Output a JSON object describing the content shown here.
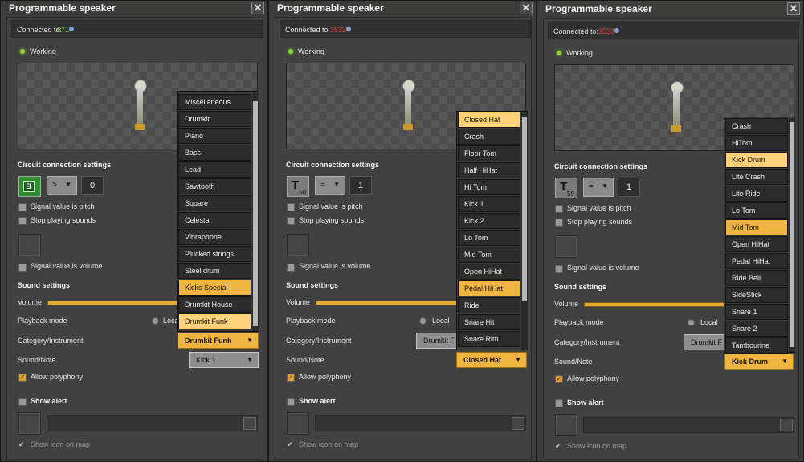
{
  "windows": [
    {
      "title": "Programmable speaker",
      "connected_label": "Connected to:",
      "connected_value": "671",
      "connected_color": "#7fcf4a",
      "status": "Working",
      "circuit_heading": "Circuit connection settings",
      "signal_icon": "green-chip-icon",
      "signal_sub": "",
      "comparator": ">",
      "constant": "0",
      "pitch_label": "Signal value is pitch",
      "stop_label": "Stop playing sounds",
      "volume_signal_label": "Signal value is volume",
      "sound_heading": "Sound settings",
      "volume_label": "Volume",
      "volume_fraction": 1.0,
      "playback_label": "Playback mode",
      "playback_option": "Local",
      "category_label": "Category/Instrument",
      "category_value": "Drumkit Funk",
      "note_label": "Sound/Note",
      "note_value": "Kick 1",
      "polyphony_label": "Allow polyphony",
      "alert_label": "Show alert",
      "show_icon_label": "Show icon on map",
      "dropdown_items": [
        "Miscellaneous",
        "Drumkit",
        "Piano",
        "Bass",
        "Lead",
        "Sawtooth",
        "Square",
        "Celesta",
        "Vibraphone",
        "Plucked strings",
        "Steel drum",
        "Kicks Special",
        "Drumkit House",
        "Drumkit Funk"
      ],
      "dropdown_selected": "Kicks Special",
      "dropdown_hovered": "Drumkit Funk"
    },
    {
      "title": "Programmable speaker",
      "connected_label": "Connected to:",
      "connected_value": "3533",
      "connected_color": "#e0463a",
      "status": "Working",
      "circuit_heading": "Circuit connection settings",
      "signal_icon": "signal-t-icon",
      "signal_sub": "50",
      "comparator": "=",
      "constant": "1",
      "pitch_label": "Signal value is pitch",
      "stop_label": "Stop playing sounds",
      "volume_signal_label": "Signal value is volume",
      "sound_heading": "Sound settings",
      "volume_label": "Volume",
      "volume_fraction": 1.0,
      "playback_label": "Playback mode",
      "playback_option": "Local",
      "category_label": "Category/Instrument",
      "category_value": "Drumkit F",
      "note_label": "Sound/Note",
      "note_value": "Closed Hat",
      "polyphony_label": "Allow polyphony",
      "alert_label": "Show alert",
      "show_icon_label": "Show icon on map",
      "dropdown_items": [
        "Closed Hat",
        "Crash",
        "Floor Tom",
        "Half HiHat",
        "Hi Tom",
        "Kick 1",
        "Kick 2",
        "Lo Tom",
        "Mid Tom",
        "Open HiHat",
        "Pedal HiHat",
        "Ride",
        "Snare Hit",
        "Snare Rim"
      ],
      "dropdown_selected": "Pedal HiHat",
      "dropdown_hovered": "Closed Hat"
    },
    {
      "title": "Programmable speaker",
      "connected_label": "Connected to:",
      "connected_value": "3533",
      "connected_color": "#e0463a",
      "status": "Working",
      "circuit_heading": "Circuit connection settings",
      "signal_icon": "signal-t-icon",
      "signal_sub": "59",
      "comparator": "=",
      "constant": "1",
      "pitch_label": "Signal value is pitch",
      "stop_label": "Stop playing sounds",
      "volume_signal_label": "Signal value is volume",
      "sound_heading": "Sound settings",
      "volume_label": "Volume",
      "volume_fraction": 1.0,
      "playback_label": "Playback mode",
      "playback_option": "Local",
      "category_label": "Category/Instrument",
      "category_value": "Drumkit F",
      "note_label": "Sound/Note",
      "note_value": "Kick Drum",
      "polyphony_label": "Allow polyphony",
      "alert_label": "Show alert",
      "show_icon_label": "Show icon on map",
      "dropdown_items": [
        "Crash",
        "HiTom",
        "Kick Drum",
        "Lite Crash",
        "Lite Ride",
        "Lo Tom",
        "Mid Tom",
        "Open HiHat",
        "Pedal HiHat",
        "Ride Bell",
        "SideStick",
        "Snare 1",
        "Snare 2",
        "Tambourine"
      ],
      "dropdown_selected": "Mid Tom",
      "dropdown_hovered": "Kick Drum"
    }
  ]
}
